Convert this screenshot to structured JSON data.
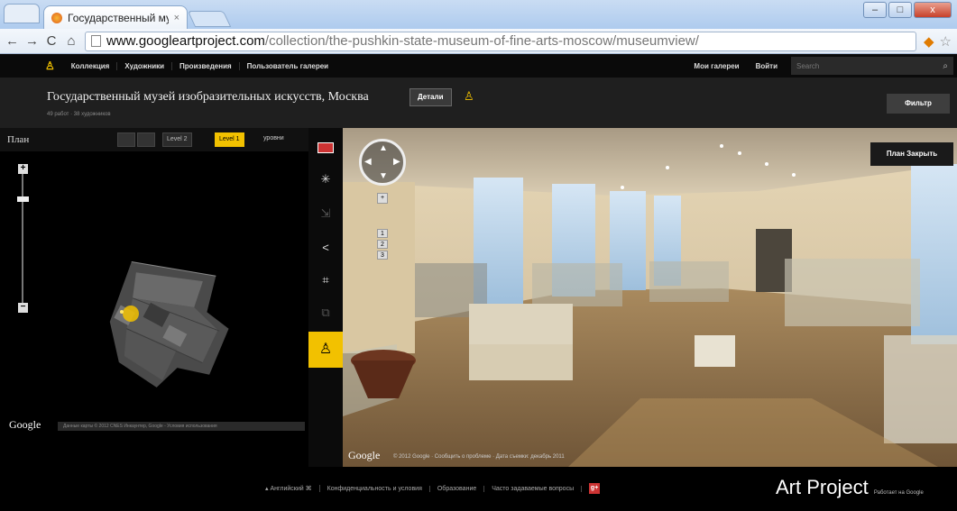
{
  "browser": {
    "tab_title": "Государственный му",
    "tab_close": "×",
    "url_host": "www.googleartproject.com",
    "url_path": "/collection/the-pushkin-state-museum-of-fine-arts-moscow/museumview/",
    "window_controls": {
      "minimize": "–",
      "maximize": "□",
      "close": "x"
    },
    "nav": {
      "back": "←",
      "forward": "→",
      "reload": "C",
      "home": "⌂"
    }
  },
  "navbar": {
    "items": [
      "Коллекция",
      "Художники",
      "Произведения",
      "Пользователь галереи"
    ],
    "my_galleries": "Мои галереи",
    "login": "Войти",
    "search_placeholder": "Search"
  },
  "title_band": {
    "museum_title": "Государственный музей изобразительных искусств, Москва",
    "details_button": "Детали",
    "subtitle": "49 работ · 38 художников",
    "filter_button": "Фильтр"
  },
  "plan": {
    "title": "План",
    "level_2": "Level 2",
    "level_1": "Level 1",
    "levels_label": "уровни",
    "google_logo": "Google",
    "attribution": "Данные карты © 2012 CNES Инкаунтер, Google - Условия использования"
  },
  "streetview": {
    "close_plan_button": "План Закрыть",
    "google_logo": "Google",
    "attribution": "© 2012 Google · Сообщить о проблеме · Дата съемки: декабрь 2011",
    "zoom_plus": "+",
    "zoom_levels": [
      "1",
      "2",
      "3"
    ]
  },
  "footer": {
    "language": "Английский",
    "links": [
      "Конфиденциальность и условия",
      "Образование",
      "Часто задаваемые вопросы"
    ],
    "brand": "Art Project",
    "brand_sub": "Работает на Google"
  },
  "colors": {
    "accent": "#f2c100",
    "background": "#000000",
    "panel": "#1f1f1f"
  }
}
